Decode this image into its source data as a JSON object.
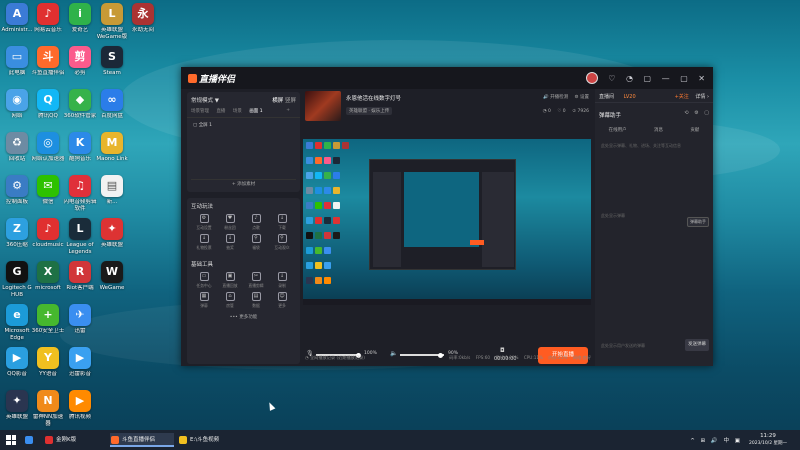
{
  "desktop": {
    "icons": [
      {
        "label": "Administr...",
        "glyph": "A",
        "color": "#3b7bd6",
        "col": 0,
        "row": 0
      },
      {
        "label": "网易云音乐",
        "glyph": "♪",
        "color": "#e03030",
        "col": 1,
        "row": 0
      },
      {
        "label": "爱奇艺",
        "glyph": "i",
        "color": "#2fb24a",
        "col": 2,
        "row": 0
      },
      {
        "label": "英雄联盟 WeGame版",
        "glyph": "L",
        "color": "#c79a36",
        "col": 3,
        "row": 0
      },
      {
        "label": "永劫无间",
        "glyph": "永",
        "color": "#a33",
        "col": 4,
        "row": 0
      },
      {
        "label": "此电脑",
        "glyph": "▭",
        "color": "#3a8ee0",
        "col": 0,
        "row": 1
      },
      {
        "label": "斗鱼直播伴侣",
        "glyph": "斗",
        "color": "#ff6a2b",
        "col": 1,
        "row": 1
      },
      {
        "label": "必剪",
        "glyph": "剪",
        "color": "#fb5b8c",
        "col": 2,
        "row": 1
      },
      {
        "label": "Steam",
        "glyph": "S",
        "color": "#1b2838",
        "col": 3,
        "row": 1
      },
      {
        "label": "网络",
        "glyph": "◉",
        "color": "#4aa3e8",
        "col": 0,
        "row": 2
      },
      {
        "label": "腾讯QQ",
        "glyph": "Q",
        "color": "#12b7f5",
        "col": 1,
        "row": 2
      },
      {
        "label": "360软件管家",
        "glyph": "◆",
        "color": "#36b24a",
        "col": 2,
        "row": 2
      },
      {
        "label": "百度网盘",
        "glyph": "∞",
        "color": "#2b7de9",
        "col": 3,
        "row": 2
      },
      {
        "label": "回收站",
        "glyph": "♻",
        "color": "#6d8ba3",
        "col": 0,
        "row": 3
      },
      {
        "label": "网络认加速器",
        "glyph": "◎",
        "color": "#1d8fe0",
        "col": 1,
        "row": 3
      },
      {
        "label": "酷狗音乐",
        "glyph": "K",
        "color": "#2c8ae8",
        "col": 2,
        "row": 3
      },
      {
        "label": "Maono Link",
        "glyph": "M",
        "color": "#e8b52c",
        "col": 3,
        "row": 3
      },
      {
        "label": "控制面板",
        "glyph": "⚙",
        "color": "#3a7cc4",
        "col": 0,
        "row": 4
      },
      {
        "label": "微信",
        "glyph": "✉",
        "color": "#2dc100",
        "col": 1,
        "row": 4
      },
      {
        "label": "闪电音频剪辑软件",
        "glyph": "♫",
        "color": "#e0303a",
        "col": 2,
        "row": 4
      },
      {
        "label": "新...",
        "glyph": "▤",
        "color": "#f2f2f2",
        "col": 3,
        "row": 4
      },
      {
        "label": "360压缩",
        "glyph": "Z",
        "color": "#2da0e0",
        "col": 0,
        "row": 5
      },
      {
        "label": "cloudmusic",
        "glyph": "♪",
        "color": "#e03030",
        "col": 1,
        "row": 5
      },
      {
        "label": "League of Legends",
        "glyph": "L",
        "color": "#1a2c3a",
        "col": 2,
        "row": 5
      },
      {
        "label": "英雄联盟",
        "glyph": "✦",
        "color": "#d33",
        "col": 3,
        "row": 5
      },
      {
        "label": "Logitech G HUB",
        "glyph": "G",
        "color": "#111",
        "col": 0,
        "row": 6
      },
      {
        "label": "microsoft",
        "glyph": "X",
        "color": "#1e7145",
        "col": 1,
        "row": 6
      },
      {
        "label": "Riot客户端",
        "glyph": "R",
        "color": "#d13639",
        "col": 2,
        "row": 6
      },
      {
        "label": "WeGame",
        "glyph": "W",
        "color": "#1a1a1a",
        "col": 3,
        "row": 6
      },
      {
        "label": "Microsoft Edge",
        "glyph": "e",
        "color": "#1c9bd8",
        "col": 0,
        "row": 7
      },
      {
        "label": "360安全卫士",
        "glyph": "+",
        "color": "#46b82e",
        "col": 1,
        "row": 7
      },
      {
        "label": "迅雷",
        "glyph": "✈",
        "color": "#3a8ef0",
        "col": 2,
        "row": 7
      },
      {
        "label": "QQ影音",
        "glyph": "▶",
        "color": "#2a9fe0",
        "col": 0,
        "row": 8
      },
      {
        "label": "YY语音",
        "glyph": "Y",
        "color": "#f0c020",
        "col": 1,
        "row": 8
      },
      {
        "label": "迅雷影音",
        "glyph": "▶",
        "color": "#3aa0f0",
        "col": 2,
        "row": 8
      },
      {
        "label": "英雄联盟",
        "glyph": "✦",
        "color": "#2a3550",
        "col": 0,
        "row": 9
      },
      {
        "label": "雷神NN加速器",
        "glyph": "N",
        "color": "#f08a1a",
        "col": 1,
        "row": 9
      },
      {
        "label": "腾讯视频",
        "glyph": "▶",
        "color": "#ff8a00",
        "col": 2,
        "row": 9
      }
    ]
  },
  "app": {
    "logo": "直播伴侣",
    "title_icons": [
      "♡",
      "◔",
      "▢",
      "—",
      "▢",
      "✕"
    ],
    "left_panel": {
      "mode": "常规模式 ▼",
      "mode_right_a": "横屏",
      "mode_right_b": "竖屏",
      "tabs": [
        "场景管理",
        "直播",
        "场景",
        "画面 1"
      ],
      "add_tab": "+",
      "scene": "全屏 1",
      "add_source": "+ 添加素材"
    },
    "interact": {
      "title": "互动玩法",
      "tools": [
        {
          "icon": "⚙",
          "label": "互动设置"
        },
        {
          "icon": "♥",
          "label": "粉丝团"
        },
        {
          "icon": "♪",
          "label": "点歌"
        },
        {
          "icon": "↓",
          "label": "下载"
        },
        {
          "icon": "↓",
          "label": "礼物投票"
        },
        {
          "icon": "↓",
          "label": "抽奖"
        },
        {
          "icon": "⚲",
          "label": "福袋"
        },
        {
          "icon": "⚲",
          "label": "互动观众"
        }
      ]
    },
    "basic": {
      "title": "基础工具",
      "tools": [
        {
          "icon": "▭",
          "label": "任务中心"
        },
        {
          "icon": "▣",
          "label": "直播回放"
        },
        {
          "icon": "✂",
          "label": "直播剪辑"
        },
        {
          "icon": "↓",
          "label": "录制"
        },
        {
          "icon": "▦",
          "label": "弹幕"
        },
        {
          "icon": "⌂",
          "label": "房管"
        },
        {
          "icon": "▤",
          "label": "数据"
        },
        {
          "icon": "☺",
          "label": "更多"
        }
      ],
      "more": "••• 更多功能"
    },
    "center": {
      "channel_title": "永恩他活在线数字灯号",
      "channel_meta": "英雄联盟 · 娱乐上传",
      "top_right": [
        "🔊 开播检测",
        "⚙ 设置"
      ],
      "stats": [
        "◔ 0",
        "♡ 0",
        "♔ 7926"
      ],
      "mic_pct": "100%",
      "spk_pct": "90%",
      "timer": "00:00:00",
      "start_button": "开始直播",
      "status_left": "◔ 全网播放记录 (近期播放记录)",
      "status_right": [
        "码率:0kb/s",
        "FPS:60",
        "丢帧:0.00%",
        "CPU:11%",
        "内存:21%",
        "网络:良好"
      ]
    },
    "right_panel": {
      "room": "直播间",
      "level": "LV20",
      "top_right_orange": "+关注",
      "top_right": "详情 ›",
      "title": "弹幕助手",
      "title_icons": [
        "⟲",
        "⚙",
        "▢"
      ],
      "tabs": [
        "在线用户",
        "消息",
        "贡献"
      ],
      "hint_top": "此处显示弹幕、礼物、进场、关注等互动信息",
      "hint_mid": "此处显示弹幕",
      "option": "弹幕助手",
      "input_placeholder": "此处显示用户发送的弹幕",
      "send": "发送弹幕"
    }
  },
  "taskbar": {
    "items": [
      {
        "label": "",
        "color": "#3a8ef0"
      },
      {
        "label": "金刚K版",
        "color": "#e03030"
      },
      {
        "label": "斗鱼直播伴侣",
        "color": "#ff6a2b"
      },
      {
        "label": "E:\\斗鱼视频",
        "color": "#f0c020"
      }
    ],
    "tray_icons": [
      "^",
      "⊞",
      "🔊",
      "中",
      "▣"
    ],
    "time": "11:29",
    "date": "2023/10/2 星期一"
  }
}
